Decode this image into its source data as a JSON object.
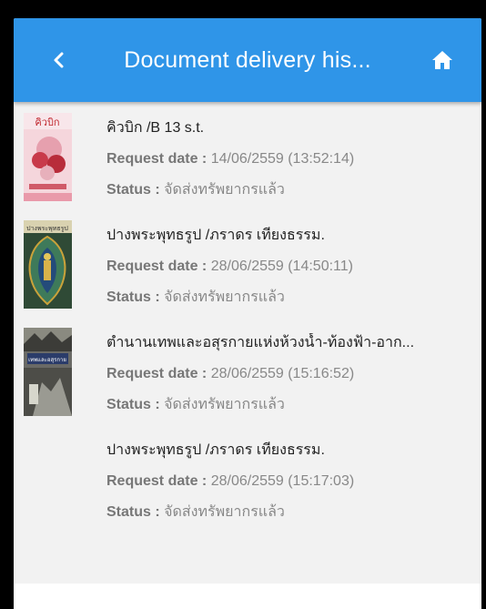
{
  "header": {
    "title": "Document delivery his...",
    "back_icon": "chevron-left-icon",
    "home_icon": "home-icon",
    "color": "#2f95e8"
  },
  "labels": {
    "request_date": "Request date :",
    "status": "Status :"
  },
  "items": [
    {
      "title": "คิวบิก /B 13 s.t.",
      "request_date": "14/06/2559 (13:52:14)",
      "status": "จัดส่งทรัพยากรแล้ว",
      "cover_text": "คิวบิก"
    },
    {
      "title": "ปางพระพุทธรูป /ภราดร เทียงธรรม.",
      "request_date": "28/06/2559 (14:50:11)",
      "status": "จัดส่งทรัพยากรแล้ว",
      "cover_text": "ปางพระพุทธรูป"
    },
    {
      "title": "ตำนานเทพและอสุรกายแห่งห้วงน้ำ-ท้องฟ้า-อาก...",
      "request_date": "28/06/2559 (15:16:52)",
      "status": "จัดส่งทรัพยากรแล้ว",
      "cover_text": "เทพและอสุรกาย"
    },
    {
      "title": "ปางพระพุทธรูป /ภราดร เทียงธรรม.",
      "request_date": "28/06/2559 (15:17:03)",
      "status": "จัดส่งทรัพยากรแล้ว"
    }
  ]
}
